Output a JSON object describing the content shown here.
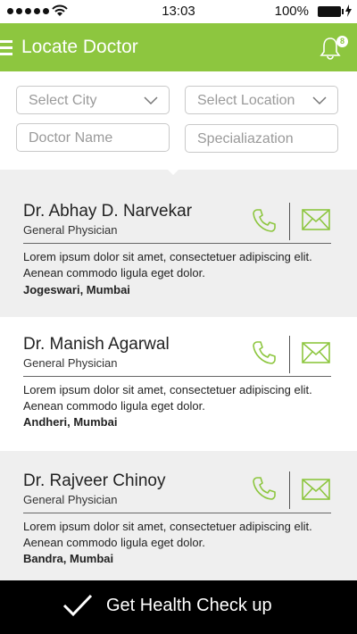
{
  "status_bar": {
    "time": "13:03",
    "battery": "100%"
  },
  "header": {
    "title": "Locate Doctor",
    "notification_count": "8"
  },
  "filters": {
    "city_placeholder": "Select City",
    "location_placeholder": "Select Location",
    "doctor_name_placeholder": "Doctor Name",
    "specialization_placeholder": "Specialiazation"
  },
  "doctors": [
    {
      "name": "Dr. Abhay D. Narvekar",
      "specialty": "General Physician",
      "description_line1": "Lorem ipsum dolor sit amet, consectetuer adipiscing elit.",
      "description_line2": "Aenean commodo ligula eget dolor.",
      "location": "Jogeswari, Mumbai"
    },
    {
      "name": "Dr. Manish Agarwal",
      "specialty": "General Physician",
      "description_line1": "Lorem ipsum dolor sit amet, consectetuer adipiscing elit.",
      "description_line2": "Aenean commodo ligula eget dolor.",
      "location": "Andheri, Mumbai"
    },
    {
      "name": "Dr. Rajveer Chinoy",
      "specialty": "General Physician",
      "description_line1": "Lorem ipsum dolor sit amet, consectetuer adipiscing elit.",
      "description_line2": "Aenean commodo ligula eget dolor.",
      "location": "Bandra, Mumbai"
    }
  ],
  "footer": {
    "action_label": "Get Health Check up"
  },
  "icons": {
    "menu": "hamburger-menu-icon",
    "notification": "bell-icon",
    "dropdown": "chevron-down-icon",
    "call": "phone-icon",
    "message": "envelope-icon",
    "confirm": "checkmark-icon"
  },
  "colors": {
    "brand_green": "#8dc63f",
    "card_gray": "#efefef",
    "footer_black": "#000000"
  }
}
